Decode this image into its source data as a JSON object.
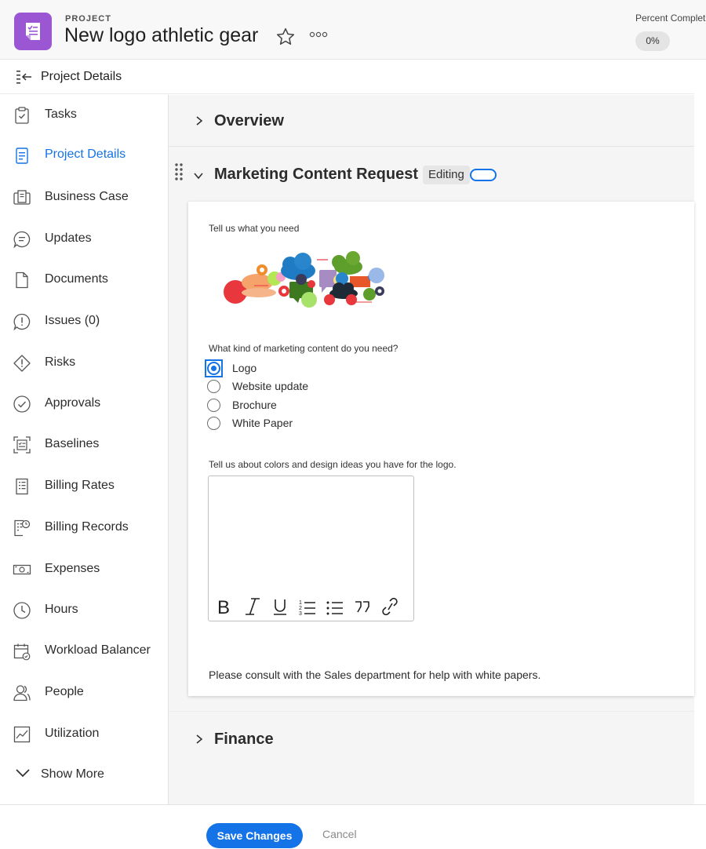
{
  "header": {
    "label": "PROJECT",
    "title": "New logo athletic gear",
    "percent_label": "Percent Complete",
    "percent_value": "0%"
  },
  "subheader": {
    "title": "Project Details"
  },
  "sidebar": {
    "items": [
      {
        "label": "Tasks",
        "icon": "clipboard-check-icon"
      },
      {
        "label": "Project Details",
        "icon": "document-icon",
        "active": true
      },
      {
        "label": "Business Case",
        "icon": "business-case-icon"
      },
      {
        "label": "Updates",
        "icon": "chat-bubble-icon"
      },
      {
        "label": "Documents",
        "icon": "file-icon"
      },
      {
        "label": "Issues (0)",
        "icon": "issue-icon"
      },
      {
        "label": "Risks",
        "icon": "risk-icon"
      },
      {
        "label": "Approvals",
        "icon": "checkmark-circle-icon"
      },
      {
        "label": "Baselines",
        "icon": "baseline-icon"
      },
      {
        "label": "Billing Rates",
        "icon": "billing-rates-icon"
      },
      {
        "label": "Billing Records",
        "icon": "billing-records-icon"
      },
      {
        "label": "Expenses",
        "icon": "money-icon"
      },
      {
        "label": "Hours",
        "icon": "clock-icon"
      },
      {
        "label": "Workload Balancer",
        "icon": "calendar-icon"
      },
      {
        "label": "People",
        "icon": "people-icon"
      },
      {
        "label": "Utilization",
        "icon": "line-chart-icon"
      },
      {
        "label": "Show More",
        "icon": "chevron-down-icon"
      }
    ]
  },
  "sections": {
    "overview": "Overview",
    "mcr": "Marketing Content Request",
    "editing": "Editing",
    "finance": "Finance"
  },
  "form": {
    "q1": "Tell us what you need",
    "q2": "What kind of marketing content do you need?",
    "options": [
      "Logo",
      "Website update",
      "Brochure",
      "White Paper"
    ],
    "selected": "Logo",
    "q3": "Tell us about colors and design ideas you have for the logo.",
    "textarea_value": "",
    "note": "Please consult with the Sales department for help with white papers."
  },
  "footer": {
    "save": "Save Changes",
    "cancel": "Cancel"
  },
  "colors": {
    "accent": "#1473e6",
    "project_icon": "#9b57d3"
  }
}
